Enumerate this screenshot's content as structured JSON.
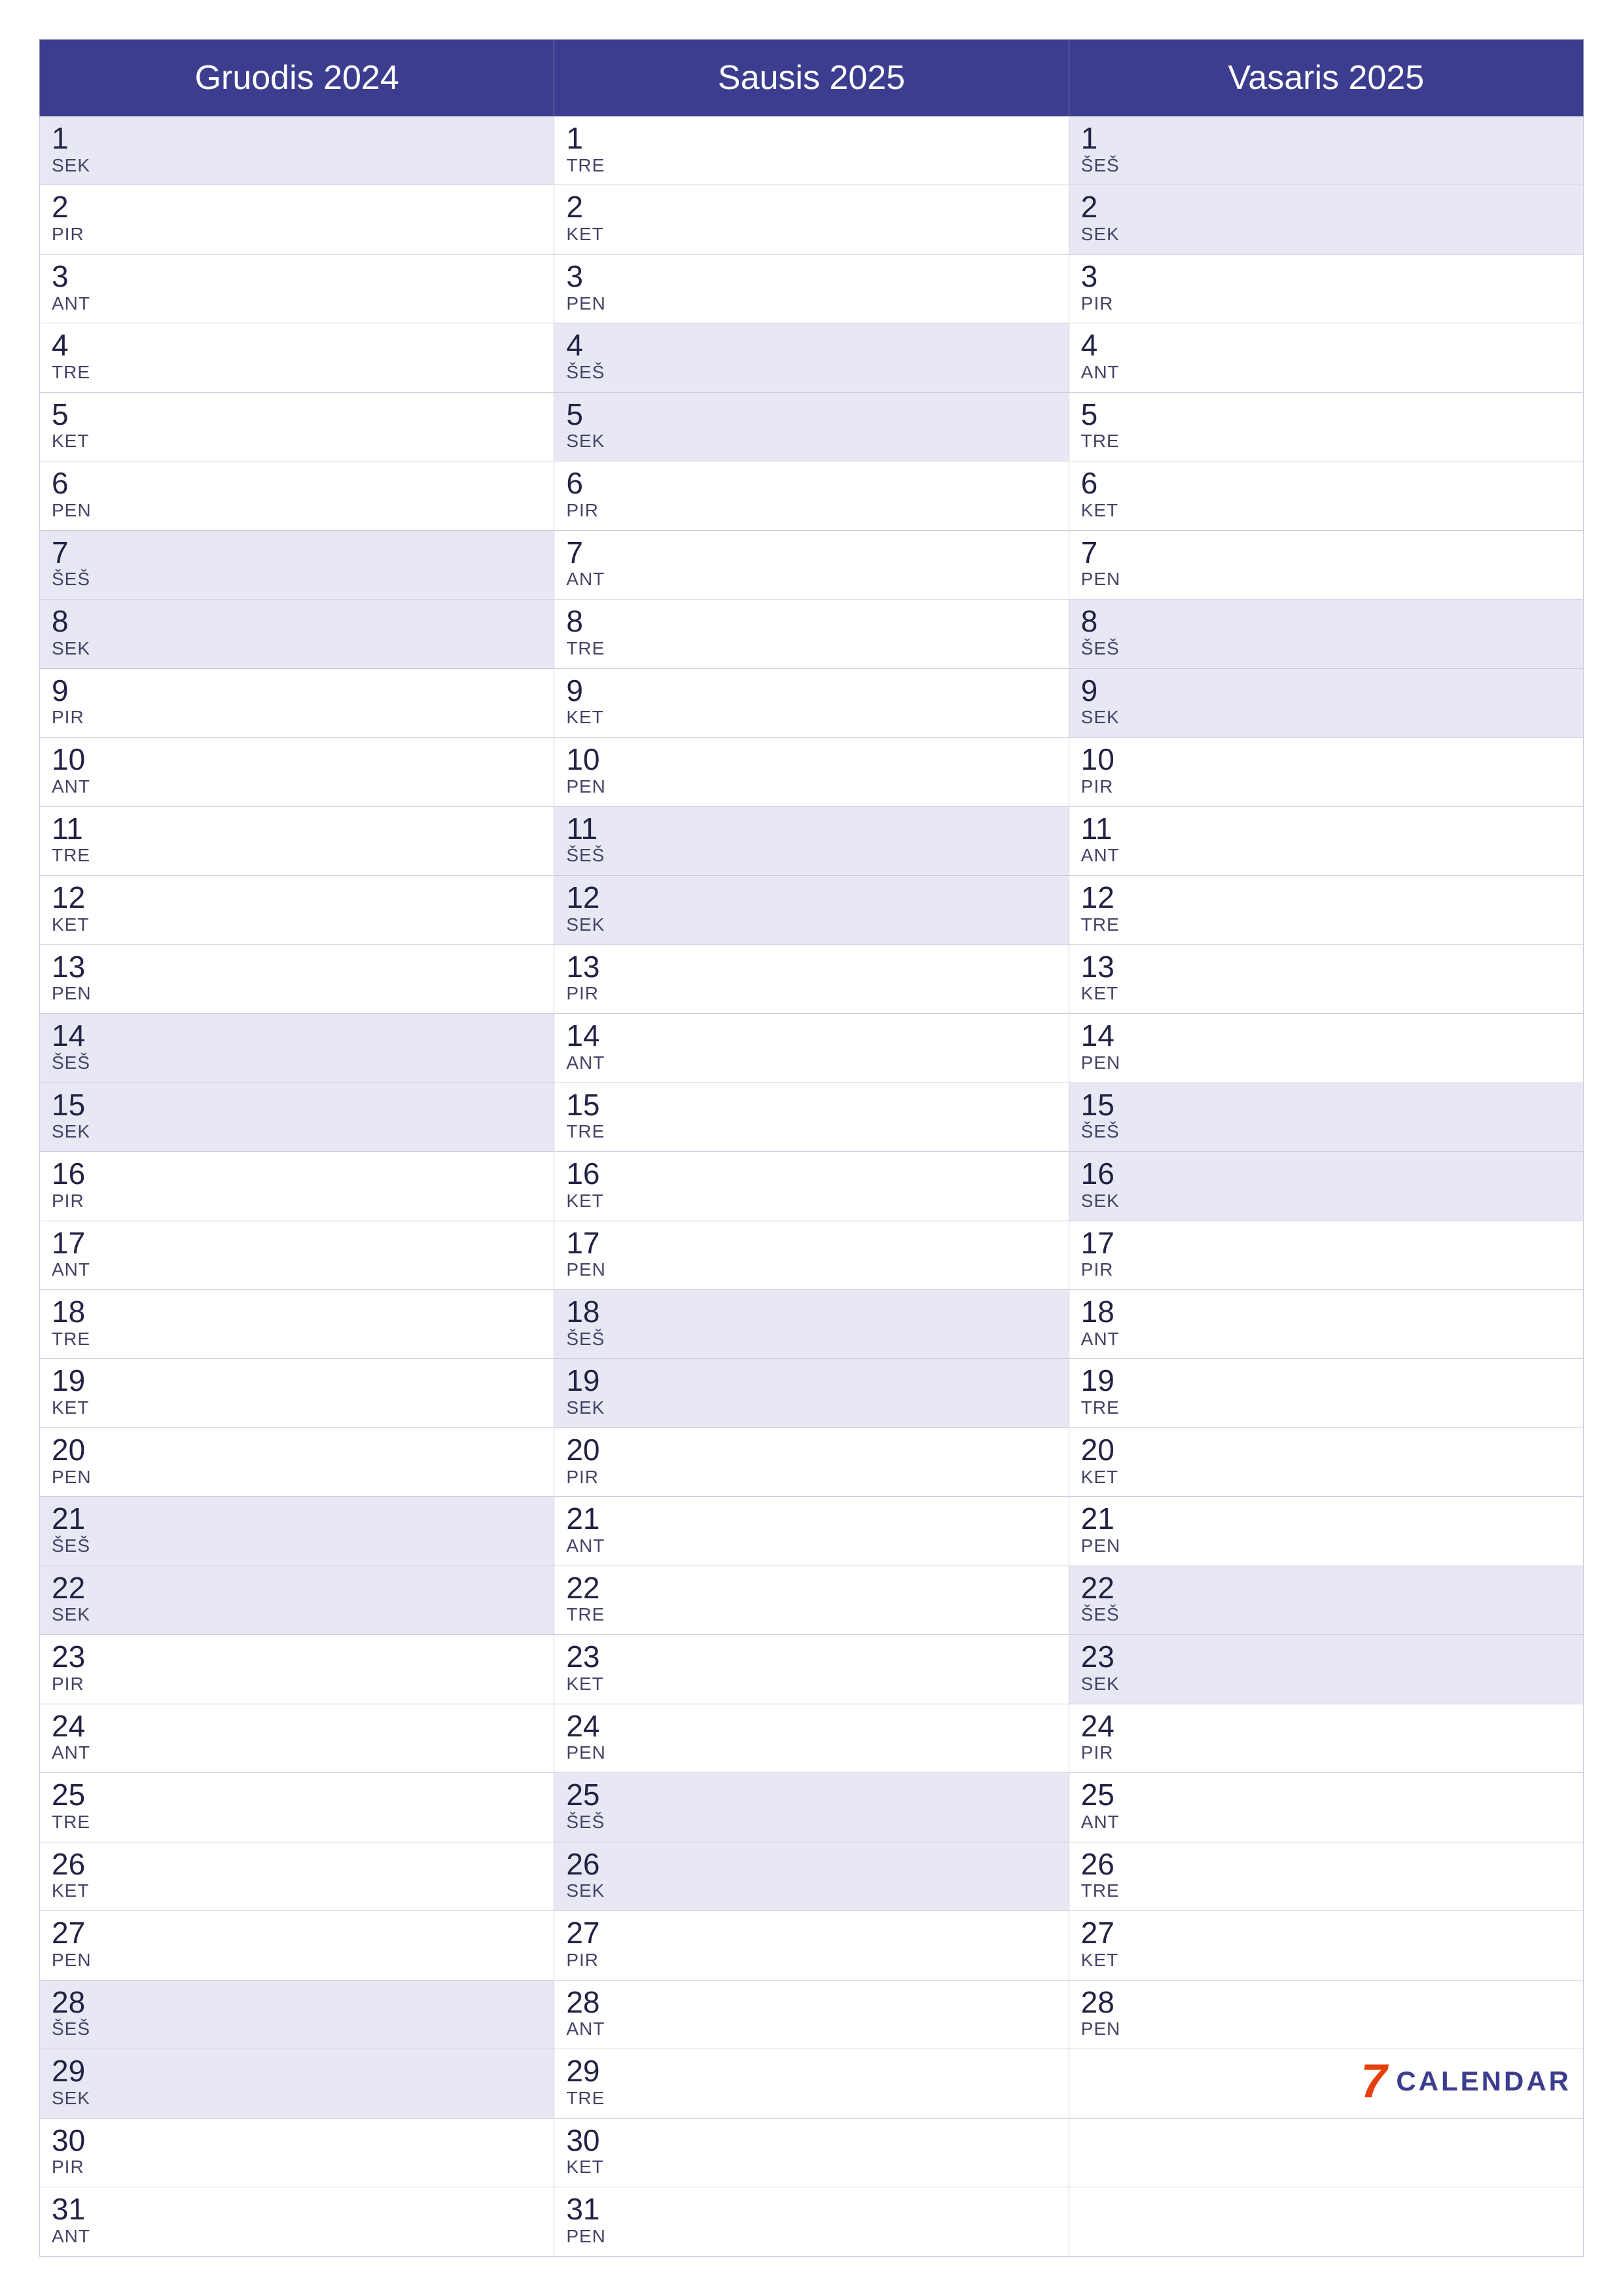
{
  "months": [
    {
      "label": "Gruodis 2024"
    },
    {
      "label": "Sausis 2025"
    },
    {
      "label": "Vasaris 2025"
    }
  ],
  "rows": [
    [
      {
        "day": "1",
        "abbr": "SEK",
        "weekend": true
      },
      {
        "day": "1",
        "abbr": "TRE",
        "weekend": false
      },
      {
        "day": "1",
        "abbr": "ŠEŠ",
        "weekend": true
      }
    ],
    [
      {
        "day": "2",
        "abbr": "PIR",
        "weekend": false
      },
      {
        "day": "2",
        "abbr": "KET",
        "weekend": false
      },
      {
        "day": "2",
        "abbr": "SEK",
        "weekend": true
      }
    ],
    [
      {
        "day": "3",
        "abbr": "ANT",
        "weekend": false
      },
      {
        "day": "3",
        "abbr": "PEN",
        "weekend": false
      },
      {
        "day": "3",
        "abbr": "PIR",
        "weekend": false
      }
    ],
    [
      {
        "day": "4",
        "abbr": "TRE",
        "weekend": false
      },
      {
        "day": "4",
        "abbr": "ŠEŠ",
        "weekend": true
      },
      {
        "day": "4",
        "abbr": "ANT",
        "weekend": false
      }
    ],
    [
      {
        "day": "5",
        "abbr": "KET",
        "weekend": false
      },
      {
        "day": "5",
        "abbr": "SEK",
        "weekend": true
      },
      {
        "day": "5",
        "abbr": "TRE",
        "weekend": false
      }
    ],
    [
      {
        "day": "6",
        "abbr": "PEN",
        "weekend": false
      },
      {
        "day": "6",
        "abbr": "PIR",
        "weekend": false
      },
      {
        "day": "6",
        "abbr": "KET",
        "weekend": false
      }
    ],
    [
      {
        "day": "7",
        "abbr": "ŠEŠ",
        "weekend": true
      },
      {
        "day": "7",
        "abbr": "ANT",
        "weekend": false
      },
      {
        "day": "7",
        "abbr": "PEN",
        "weekend": false
      }
    ],
    [
      {
        "day": "8",
        "abbr": "SEK",
        "weekend": true
      },
      {
        "day": "8",
        "abbr": "TRE",
        "weekend": false
      },
      {
        "day": "8",
        "abbr": "ŠEŠ",
        "weekend": true
      }
    ],
    [
      {
        "day": "9",
        "abbr": "PIR",
        "weekend": false
      },
      {
        "day": "9",
        "abbr": "KET",
        "weekend": false
      },
      {
        "day": "9",
        "abbr": "SEK",
        "weekend": true
      }
    ],
    [
      {
        "day": "10",
        "abbr": "ANT",
        "weekend": false
      },
      {
        "day": "10",
        "abbr": "PEN",
        "weekend": false
      },
      {
        "day": "10",
        "abbr": "PIR",
        "weekend": false
      }
    ],
    [
      {
        "day": "11",
        "abbr": "TRE",
        "weekend": false
      },
      {
        "day": "11",
        "abbr": "ŠEŠ",
        "weekend": true
      },
      {
        "day": "11",
        "abbr": "ANT",
        "weekend": false
      }
    ],
    [
      {
        "day": "12",
        "abbr": "KET",
        "weekend": false
      },
      {
        "day": "12",
        "abbr": "SEK",
        "weekend": true
      },
      {
        "day": "12",
        "abbr": "TRE",
        "weekend": false
      }
    ],
    [
      {
        "day": "13",
        "abbr": "PEN",
        "weekend": false
      },
      {
        "day": "13",
        "abbr": "PIR",
        "weekend": false
      },
      {
        "day": "13",
        "abbr": "KET",
        "weekend": false
      }
    ],
    [
      {
        "day": "14",
        "abbr": "ŠEŠ",
        "weekend": true
      },
      {
        "day": "14",
        "abbr": "ANT",
        "weekend": false
      },
      {
        "day": "14",
        "abbr": "PEN",
        "weekend": false
      }
    ],
    [
      {
        "day": "15",
        "abbr": "SEK",
        "weekend": true
      },
      {
        "day": "15",
        "abbr": "TRE",
        "weekend": false
      },
      {
        "day": "15",
        "abbr": "ŠEŠ",
        "weekend": true
      }
    ],
    [
      {
        "day": "16",
        "abbr": "PIR",
        "weekend": false
      },
      {
        "day": "16",
        "abbr": "KET",
        "weekend": false
      },
      {
        "day": "16",
        "abbr": "SEK",
        "weekend": true
      }
    ],
    [
      {
        "day": "17",
        "abbr": "ANT",
        "weekend": false
      },
      {
        "day": "17",
        "abbr": "PEN",
        "weekend": false
      },
      {
        "day": "17",
        "abbr": "PIR",
        "weekend": false
      }
    ],
    [
      {
        "day": "18",
        "abbr": "TRE",
        "weekend": false
      },
      {
        "day": "18",
        "abbr": "ŠEŠ",
        "weekend": true
      },
      {
        "day": "18",
        "abbr": "ANT",
        "weekend": false
      }
    ],
    [
      {
        "day": "19",
        "abbr": "KET",
        "weekend": false
      },
      {
        "day": "19",
        "abbr": "SEK",
        "weekend": true
      },
      {
        "day": "19",
        "abbr": "TRE",
        "weekend": false
      }
    ],
    [
      {
        "day": "20",
        "abbr": "PEN",
        "weekend": false
      },
      {
        "day": "20",
        "abbr": "PIR",
        "weekend": false
      },
      {
        "day": "20",
        "abbr": "KET",
        "weekend": false
      }
    ],
    [
      {
        "day": "21",
        "abbr": "ŠEŠ",
        "weekend": true
      },
      {
        "day": "21",
        "abbr": "ANT",
        "weekend": false
      },
      {
        "day": "21",
        "abbr": "PEN",
        "weekend": false
      }
    ],
    [
      {
        "day": "22",
        "abbr": "SEK",
        "weekend": true
      },
      {
        "day": "22",
        "abbr": "TRE",
        "weekend": false
      },
      {
        "day": "22",
        "abbr": "ŠEŠ",
        "weekend": true
      }
    ],
    [
      {
        "day": "23",
        "abbr": "PIR",
        "weekend": false
      },
      {
        "day": "23",
        "abbr": "KET",
        "weekend": false
      },
      {
        "day": "23",
        "abbr": "SEK",
        "weekend": true
      }
    ],
    [
      {
        "day": "24",
        "abbr": "ANT",
        "weekend": false
      },
      {
        "day": "24",
        "abbr": "PEN",
        "weekend": false
      },
      {
        "day": "24",
        "abbr": "PIR",
        "weekend": false
      }
    ],
    [
      {
        "day": "25",
        "abbr": "TRE",
        "weekend": false
      },
      {
        "day": "25",
        "abbr": "ŠEŠ",
        "weekend": true
      },
      {
        "day": "25",
        "abbr": "ANT",
        "weekend": false
      }
    ],
    [
      {
        "day": "26",
        "abbr": "KET",
        "weekend": false
      },
      {
        "day": "26",
        "abbr": "SEK",
        "weekend": true
      },
      {
        "day": "26",
        "abbr": "TRE",
        "weekend": false
      }
    ],
    [
      {
        "day": "27",
        "abbr": "PEN",
        "weekend": false
      },
      {
        "day": "27",
        "abbr": "PIR",
        "weekend": false
      },
      {
        "day": "27",
        "abbr": "KET",
        "weekend": false
      }
    ],
    [
      {
        "day": "28",
        "abbr": "ŠEŠ",
        "weekend": true
      },
      {
        "day": "28",
        "abbr": "ANT",
        "weekend": false
      },
      {
        "day": "28",
        "abbr": "PEN",
        "weekend": false
      }
    ],
    [
      {
        "day": "29",
        "abbr": "SEK",
        "weekend": true
      },
      {
        "day": "29",
        "abbr": "TRE",
        "weekend": false
      },
      {
        "day": "",
        "abbr": "",
        "weekend": false,
        "empty": true,
        "logo": true
      }
    ],
    [
      {
        "day": "30",
        "abbr": "PIR",
        "weekend": false
      },
      {
        "day": "30",
        "abbr": "KET",
        "weekend": false
      },
      {
        "day": "",
        "abbr": "",
        "weekend": false,
        "empty": true
      }
    ],
    [
      {
        "day": "31",
        "abbr": "ANT",
        "weekend": false
      },
      {
        "day": "31",
        "abbr": "PEN",
        "weekend": false
      },
      {
        "day": "",
        "abbr": "",
        "weekend": false,
        "empty": true
      }
    ]
  ],
  "logo": {
    "number": "7",
    "text": "CALENDAR"
  }
}
